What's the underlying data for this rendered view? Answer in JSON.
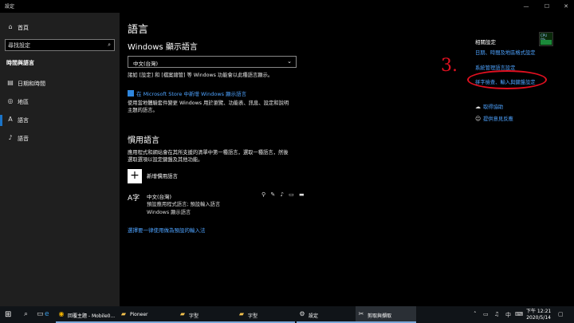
{
  "window": {
    "title": "設定",
    "minimize": "—",
    "maximize": "☐",
    "close": "✕"
  },
  "sidebar": {
    "home": "首頁",
    "search_placeholder": "尋找設定",
    "section": "時間與語言",
    "items": [
      {
        "label": "日期和時間",
        "icon": "calendar-clock-icon"
      },
      {
        "label": "地區",
        "icon": "globe-icon"
      },
      {
        "label": "語言",
        "icon": "language-icon"
      },
      {
        "label": "語音",
        "icon": "microphone-icon"
      }
    ]
  },
  "main": {
    "title": "語言",
    "display_heading": "Windows 顯示語言",
    "display_value": "中文(台灣)",
    "display_desc": "諸如 [設定] 和 [檔案總管] 等 Windows 功能會以此種語言顯示。",
    "store_link": "在 Microsoft Store 中新增 Windows 顯示語言",
    "store_desc_1": "使用當地體驗套件變更 Windows 用於瀏覽、功能表、訊息、設定和說明",
    "store_desc_2": "主題的語言。",
    "preferred_heading": "慣用語言",
    "preferred_desc_1": "應用程式和網站會在其所支援的清單中第一種語言，選取一種語言，然後",
    "preferred_desc_2": "選取選項以設定鍵盤及其他功能。",
    "add_label": "新增慣用語言",
    "lang_name": "中文(台灣)",
    "lang_sub_1": "預設應用程式語言; 預設輸入語言",
    "lang_sub_2": "Windows 顯示語言",
    "feature_icons": "⚲ ✎ ♪ ▭ ▬",
    "method_link": "選擇要一律使用做為預設的輸入法"
  },
  "related": {
    "heading": "相關設定",
    "links": [
      "日期、時間及地區格式設定",
      "系統管理語言設定",
      "拼字檢查、輸入與鍵盤設定"
    ],
    "help": [
      {
        "label": "取得協助",
        "icon": "help-icon"
      },
      {
        "label": "提供意見反應",
        "icon": "feedback-icon"
      }
    ],
    "thumb_text": "CPU 0%"
  },
  "annotation": {
    "number": "3."
  },
  "taskbar": {
    "apps": [
      {
        "label": "回覆主題 - Mobile0...",
        "icon": "chrome-icon",
        "active": false
      },
      {
        "label": "Pioneer",
        "icon": "folder-icon",
        "active": false
      },
      {
        "label": "字型",
        "icon": "folder-icon",
        "active": false
      },
      {
        "label": "字型",
        "icon": "folder-icon",
        "active": false
      },
      {
        "label": "設定",
        "icon": "gear-icon",
        "active": false
      },
      {
        "label": "剪取與擷取",
        "icon": "snip-icon",
        "active": true
      }
    ],
    "time": "下午 12:21",
    "date": "2020/5/14"
  },
  "colors": {
    "accent": "#1a73c7",
    "link": "#4ea3ff",
    "annotation": "#e01020"
  }
}
